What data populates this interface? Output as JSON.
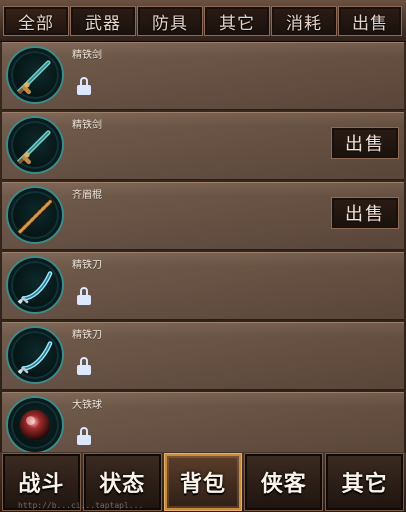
{
  "top_tabs": [
    "全部",
    "武器",
    "防具",
    "其它",
    "消耗",
    "出售"
  ],
  "items": [
    {
      "name": "精铁剑",
      "icon": "sword-icon",
      "locked": true,
      "sell_label": ""
    },
    {
      "name": "精铁剑",
      "icon": "sword-icon",
      "locked": false,
      "sell_label": "出售"
    },
    {
      "name": "齐眉棍",
      "icon": "staff-icon",
      "locked": false,
      "sell_label": "出售"
    },
    {
      "name": "精铁刀",
      "icon": "saber-icon",
      "locked": true,
      "sell_label": ""
    },
    {
      "name": "精铁刀",
      "icon": "saber-icon",
      "locked": true,
      "sell_label": ""
    },
    {
      "name": "大铁球",
      "icon": "iron-ball-icon",
      "locked": true,
      "sell_label": ""
    }
  ],
  "bottom_nav": [
    "战斗",
    "状态",
    "背包",
    "侠客",
    "其它"
  ],
  "watermark": "http://b...ci...taptapl..."
}
